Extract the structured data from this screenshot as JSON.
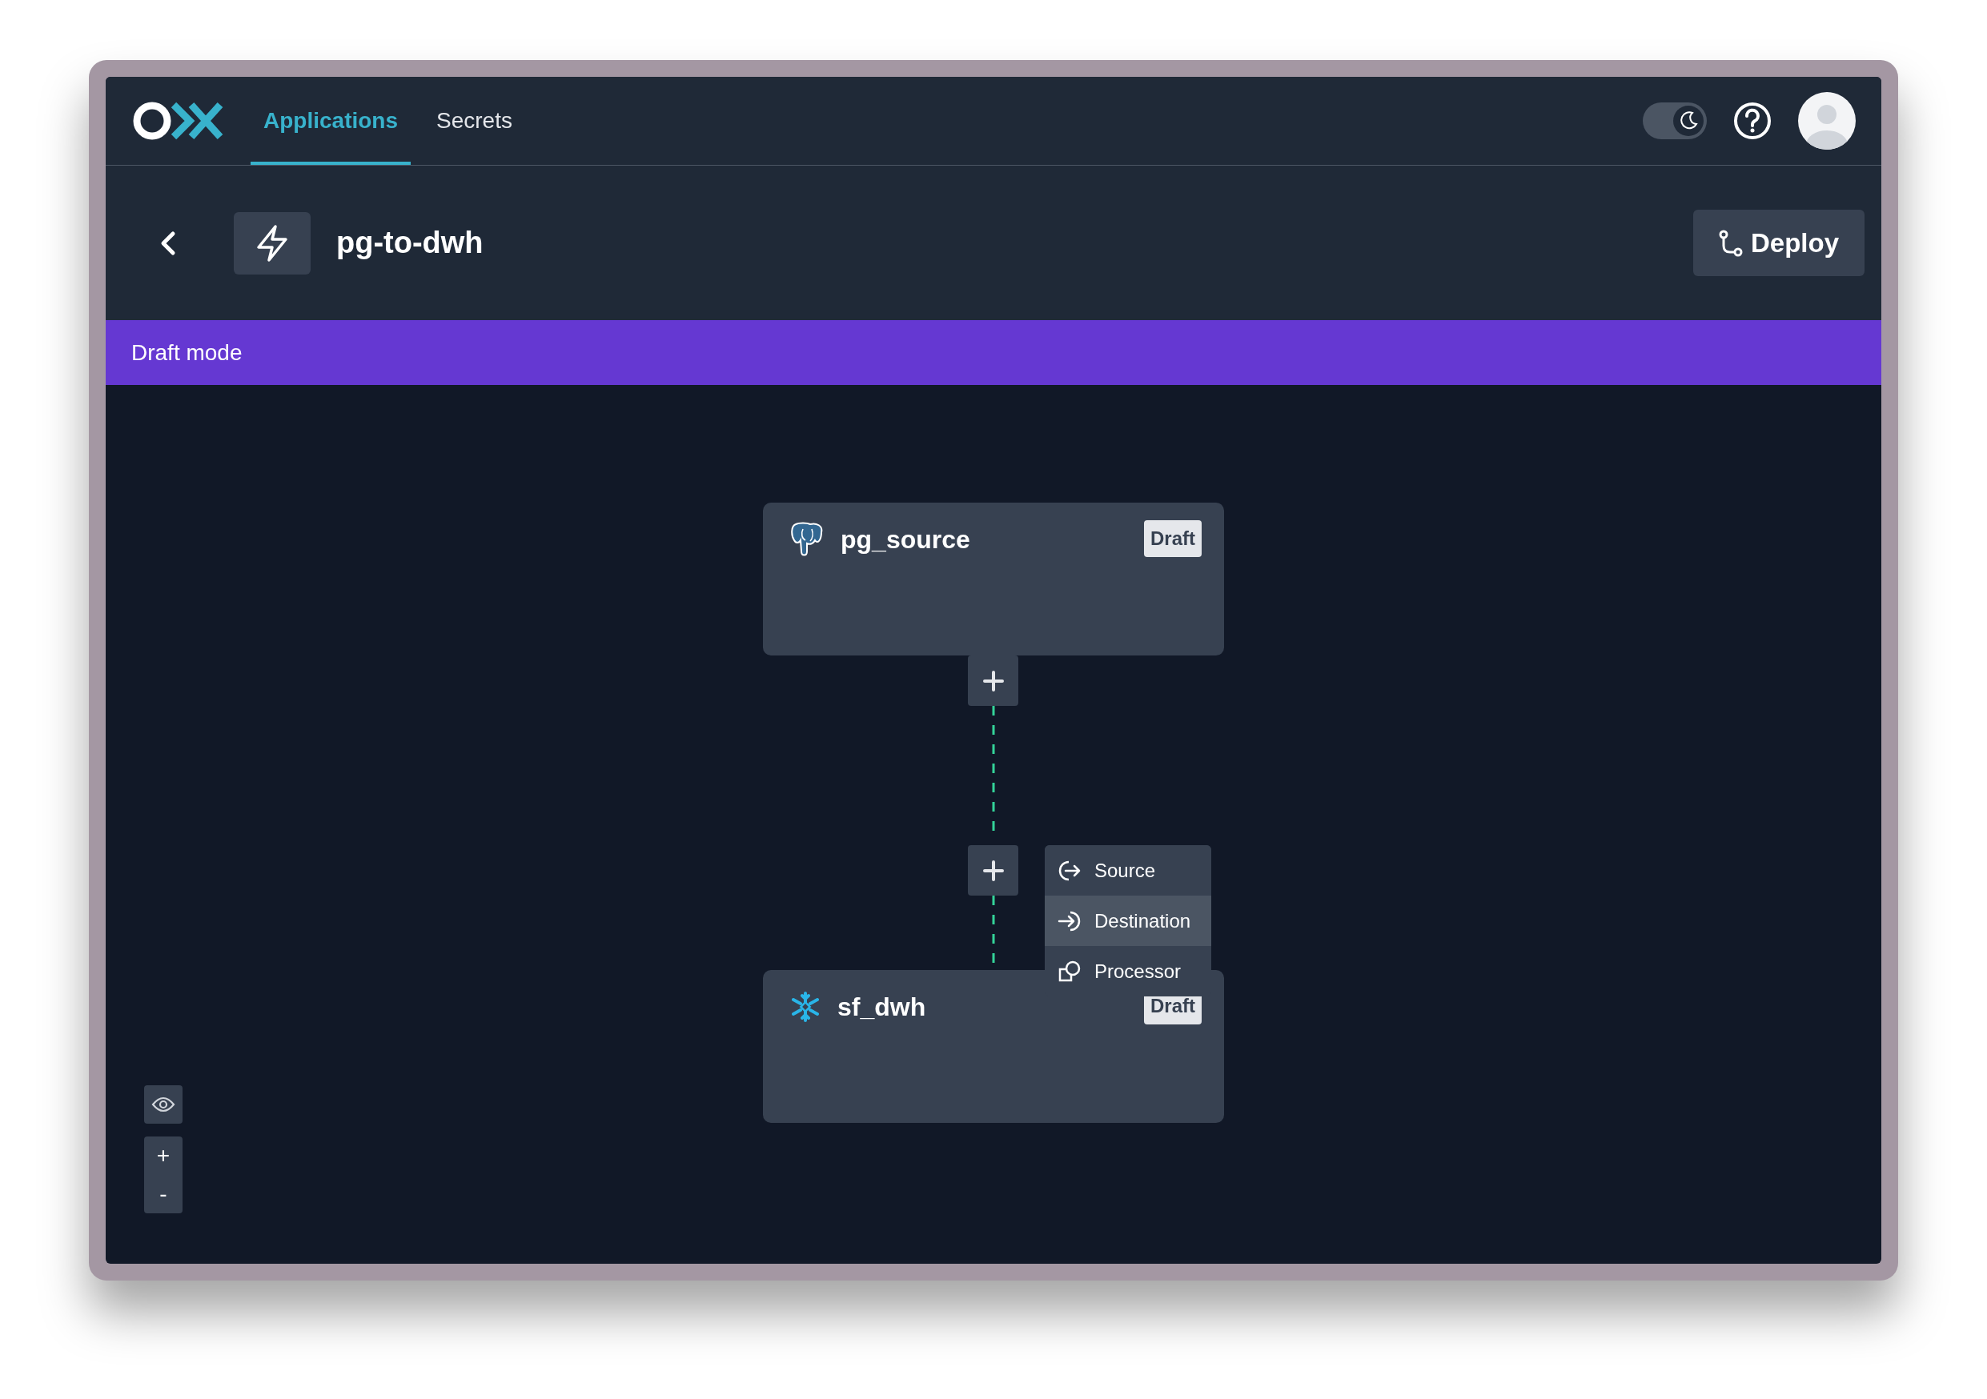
{
  "nav": {
    "tabs": [
      {
        "label": "Applications",
        "selected": true
      },
      {
        "label": "Secrets",
        "selected": false
      }
    ],
    "dark_mode": true
  },
  "header": {
    "title": "pg-to-dwh",
    "deploy_button": "Deploy"
  },
  "banner": "Draft mode",
  "nodes": [
    {
      "kind": "postgres",
      "name": "pg_source",
      "badge": "Draft"
    },
    {
      "kind": "snowflake",
      "name": "sf_dwh",
      "badge": "Draft"
    }
  ],
  "add_menu": {
    "items": [
      {
        "kind": "source",
        "label": "Source",
        "selected": false
      },
      {
        "kind": "destination",
        "label": "Destination",
        "selected": true
      },
      {
        "kind": "processor",
        "label": "Processor",
        "selected": false
      }
    ]
  },
  "zoom_controls": {
    "zoom_in": "+",
    "zoom_out": "-"
  }
}
